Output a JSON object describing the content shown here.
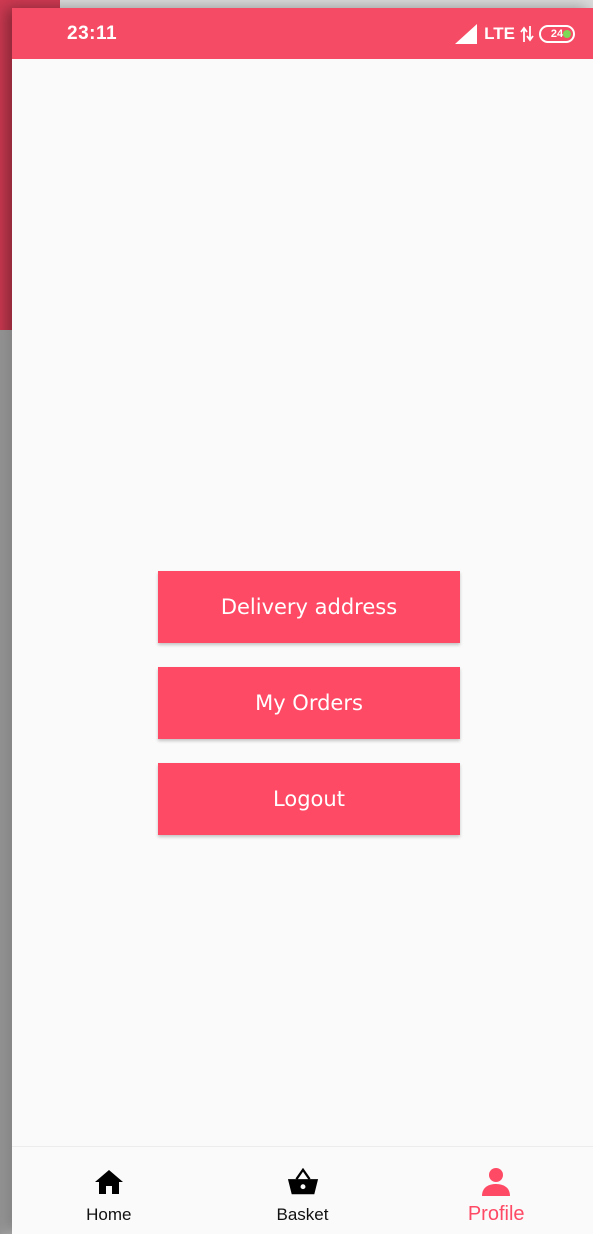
{
  "status_bar": {
    "time": "23:11",
    "network": "LTE",
    "battery_level": "24",
    "background_color": "#f64b64"
  },
  "menu": {
    "button_color": "#fe4a65",
    "delivery_address_label": "Delivery address",
    "my_orders_label": "My Orders",
    "logout_label": "Logout"
  },
  "bottom_nav": {
    "active_color": "#fe4a65",
    "items": [
      {
        "label": "Home",
        "icon": "home-icon",
        "active": false
      },
      {
        "label": "Basket",
        "icon": "basket-icon",
        "active": false
      },
      {
        "label": "Profile",
        "icon": "person-icon",
        "active": true
      }
    ]
  }
}
